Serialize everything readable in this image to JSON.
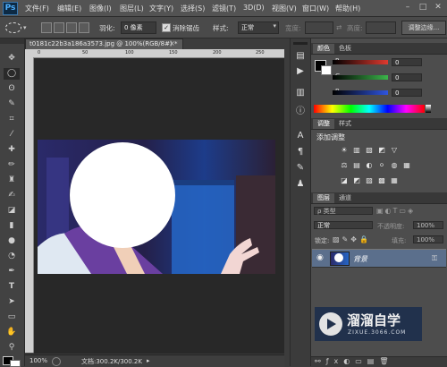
{
  "app": {
    "logo": "Ps"
  },
  "menu": [
    "文件(F)",
    "编辑(E)",
    "图像(I)",
    "图层(L)",
    "文字(Y)",
    "选择(S)",
    "滤镜(T)",
    "3D(D)",
    "视图(V)",
    "窗口(W)",
    "帮助(H)"
  ],
  "window_controls": {
    "minimize": "–",
    "maximize": "□",
    "close": "✕"
  },
  "options": {
    "feather_label": "羽化:",
    "feather_value": "0 像素",
    "antialias_label": "消除锯齿",
    "style_label": "样式:",
    "style_value": "正常",
    "width_label": "宽度:",
    "height_label": "高度:",
    "refine_button": "调整边缘..."
  },
  "document": {
    "tab_title": "t0181c22b3a186a3573.jpg @ 100%(RGB/8#) *",
    "tab_close": "×",
    "zoom": "100%",
    "doc_info": "文档:300.2K/300.2K",
    "ruler_ticks": [
      "0",
      "50",
      "100",
      "150",
      "200",
      "250"
    ]
  },
  "color_panel": {
    "tabs": [
      "颜色",
      "色板"
    ],
    "channels": [
      {
        "label": "R",
        "value": "0",
        "color": "#e03a2f"
      },
      {
        "label": "G",
        "value": "0",
        "color": "#3bb54a"
      },
      {
        "label": "B",
        "value": "0",
        "color": "#2f55e0"
      }
    ]
  },
  "adjust_panel": {
    "tabs": [
      "调整",
      "样式"
    ],
    "title": "添加调整",
    "row1": [
      "☀",
      "▥",
      "▧",
      "◩",
      "▽"
    ],
    "row2": [
      "⚖",
      "▤",
      "◐",
      "⚪",
      "◍",
      "▦"
    ],
    "row3": [
      "◪",
      "◩",
      "▨",
      "▩",
      "▦"
    ]
  },
  "layers_panel": {
    "tabs": [
      "图层",
      "通道"
    ],
    "kind_label": "ρ 类型",
    "blend_mode": "正常",
    "opacity_label": "不透明度:",
    "opacity_value": "100%",
    "lock_label": "锁定:",
    "fill_label": "填充:",
    "fill_value": "100%",
    "layer_name": "背景"
  },
  "watermark": {
    "title": "溜溜自学",
    "url": "ZIXUE.3066.COM"
  }
}
